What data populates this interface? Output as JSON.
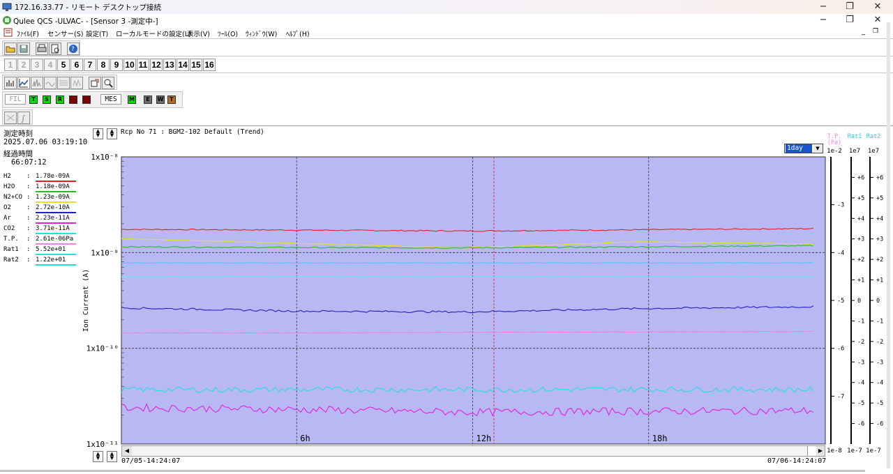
{
  "rdp": {
    "title": "172.16.33.77 - リモート デスクトップ接続"
  },
  "app": {
    "title": "Qulee QCS  -ULVAC-   - [Sensor 3 -測定中-]"
  },
  "menu": [
    "ﾌｧｲﾙ(F)",
    "センサー(S)",
    "設定(T)",
    "ローカルモードの設定(L)",
    "表示(V)",
    "ﾂｰﾙ(O)",
    "ｳｨﾝﾄﾞｳ(W)",
    "ﾍﾙﾌﾟ(H)"
  ],
  "channels": [
    "1",
    "2",
    "3",
    "4",
    "5",
    "6",
    "7",
    "8",
    "9",
    "10",
    "11",
    "12",
    "13",
    "14",
    "15",
    "16"
  ],
  "status": {
    "fil_label": "FIL",
    "fil_lamps": [
      {
        "t": "T",
        "c": "#00e000"
      },
      {
        "t": "S",
        "c": "#00e000"
      },
      {
        "t": "R",
        "c": "#00e000"
      },
      {
        "t": "",
        "c": "#7a0000"
      },
      {
        "t": "",
        "c": "#7a0000"
      }
    ],
    "mes_label": "MES",
    "mes_lamps": [
      {
        "t": "M",
        "c": "#00e000"
      },
      {
        "t": "E",
        "c": "#6e6e6e"
      },
      {
        "t": "W",
        "c": "#6e6e6e"
      },
      {
        "t": "T",
        "c": "#b07020"
      }
    ]
  },
  "left": {
    "time_label": "測定時刻",
    "time_value": "2025.07.06 03:19:10",
    "elapsed_label": "経過時間",
    "elapsed_value": "66:07:12",
    "legend": [
      {
        "name": "H2",
        "value": "1.78e-09A",
        "color": "#e02020"
      },
      {
        "name": "H2O",
        "value": "1.18e-09A",
        "color": "#20c020"
      },
      {
        "name": "N2+CO",
        "value": "1.23e-09A",
        "color": "#e8e020"
      },
      {
        "name": "O2",
        "value": "2.72e-10A",
        "color": "#2020c0"
      },
      {
        "name": "Ar",
        "value": "2.23e-11A",
        "color": "#e020e0"
      },
      {
        "name": "CO2",
        "value": "3.71e-11A",
        "color": "#20e0e0"
      },
      {
        "name": "T.P.",
        "value": "2.61e-06Pa",
        "color": "#f080e0"
      },
      {
        "name": "Rat1",
        "value": "5.52e+01",
        "color": "#20e0e0"
      },
      {
        "name": "Rat2",
        "value": "1.22e+01",
        "color": "#20e0e0"
      }
    ]
  },
  "chart": {
    "header": "Rcp No 71 : BGM2-102 Default (Trend)",
    "ylabel": "Ion Current (A)",
    "range_select": "1day",
    "start_time": "07/05-14:24:07",
    "end_time": "07/06-14:24:07",
    "right_axes": [
      {
        "name": "T.P.",
        "unit": "(Pa)",
        "scale_top": "1e-2",
        "scale_bottom": "1e-8",
        "color": "#f080e0"
      },
      {
        "name": "Rat1",
        "unit": "",
        "scale_top": "1e7",
        "scale_bottom": "1e-7",
        "color": "#20d0e0"
      },
      {
        "name": "Rat2",
        "unit": "",
        "scale_top": "1e7",
        "scale_bottom": "1e-7",
        "color": "#20d0e0"
      }
    ]
  },
  "chart_data": {
    "type": "line",
    "yscale": "log",
    "ylim": [
      1e-11,
      1e-08
    ],
    "y_ticks": [
      "1x10⁻⁸",
      "1x10⁻⁹",
      "1x10⁻¹⁰",
      "1x10⁻¹¹"
    ],
    "x_ticks": [
      "6h",
      "12h",
      "18h"
    ],
    "tp_ticks": [
      "-3",
      "-4",
      "-5",
      "-6",
      "-7"
    ],
    "rat_ticks": [
      "+6",
      "+5",
      "+4",
      "+3",
      "+2",
      "+1",
      "0",
      "-1",
      "-2",
      "-3",
      "-4",
      "-5",
      "-6"
    ],
    "x": [
      0,
      0.25,
      0.5,
      0.75,
      1.0
    ],
    "series": [
      {
        "name": "H2",
        "color": "#e02020",
        "values": [
          1.75e-09,
          1.72e-09,
          1.68e-09,
          1.73e-09,
          1.78e-09
        ]
      },
      {
        "name": "N2+CO",
        "color": "#e8e020",
        "values": [
          1.4e-09,
          1.25e-09,
          1.12e-09,
          1.3e-09,
          1.23e-09
        ]
      },
      {
        "name": "H2O",
        "color": "#20c020",
        "values": [
          1.15e-09,
          1.13e-09,
          1.12e-09,
          1.15e-09,
          1.18e-09
        ]
      },
      {
        "name": "Rat1",
        "color": "#40d0f0",
        "values": [
          7.8e-10,
          7.8e-10,
          7.8e-10,
          7.8e-10,
          7.8e-10
        ]
      },
      {
        "name": "Rat2",
        "color": "#60e8f8",
        "values": [
          5.6e-10,
          5.6e-10,
          5.6e-10,
          5.6e-10,
          5.6e-10
        ]
      },
      {
        "name": "O2",
        "color": "#2020c0",
        "values": [
          2.65e-10,
          2.45e-10,
          2.4e-10,
          2.6e-10,
          2.72e-10
        ]
      },
      {
        "name": "T.P.",
        "color": "#f080e0",
        "values": [
          1.45e-10,
          1.45e-10,
          1.47e-10,
          1.48e-10,
          1.5e-10
        ]
      },
      {
        "name": "CO2",
        "color": "#20e0e0",
        "values": [
          3.7e-11,
          3.7e-11,
          3.7e-11,
          3.72e-11,
          3.71e-11
        ]
      },
      {
        "name": "Ar",
        "color": "#e020e0",
        "values": [
          2.4e-11,
          2.3e-11,
          2.15e-11,
          2.2e-11,
          2.23e-11
        ]
      }
    ]
  }
}
